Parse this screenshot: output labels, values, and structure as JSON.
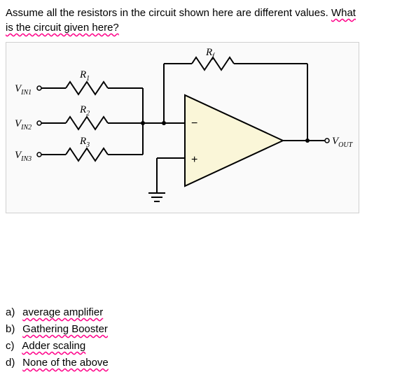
{
  "question": {
    "line1_a": "Assume all the resistors in the circuit shown here are different values.",
    "line1_b": "What",
    "line2": "is the circuit given here?"
  },
  "labels": {
    "vin1": "V",
    "vin1_sub": "IN1",
    "vin2": "V",
    "vin2_sub": "IN2",
    "vin3": "V",
    "vin3_sub": "IN3",
    "r1": "R",
    "r1_sub": "1",
    "r2": "R",
    "r2_sub": "2",
    "r3": "R",
    "r3_sub": "3",
    "rf": "R",
    "rf_sub": "f",
    "vout": "V",
    "vout_sub": "OUT",
    "minus": "−",
    "plus": "+"
  },
  "options": {
    "a": {
      "label": "a)",
      "text": "average amplifier"
    },
    "b": {
      "label": "b)",
      "text": "Gathering Booster"
    },
    "c": {
      "label": "c)",
      "text": "Adder scaling"
    },
    "d": {
      "label": "d)",
      "text": "None of the above"
    }
  },
  "chart_data": {
    "type": "table",
    "title": "Op-amp summing amplifier circuit",
    "description": "Three inputs VIN1, VIN2, VIN3 each pass through resistors R1, R2, R3 respectively into the inverting (-) input of an op-amp. A feedback resistor Rf connects the output to the inverting input. The non-inverting (+) input is tied to ground. Output node is VOUT.",
    "inputs": [
      "VIN1",
      "VIN2",
      "VIN3"
    ],
    "input_resistors": [
      "R1",
      "R2",
      "R3"
    ],
    "feedback_resistor": "Rf",
    "noninverting_input": "GND",
    "output": "VOUT"
  }
}
